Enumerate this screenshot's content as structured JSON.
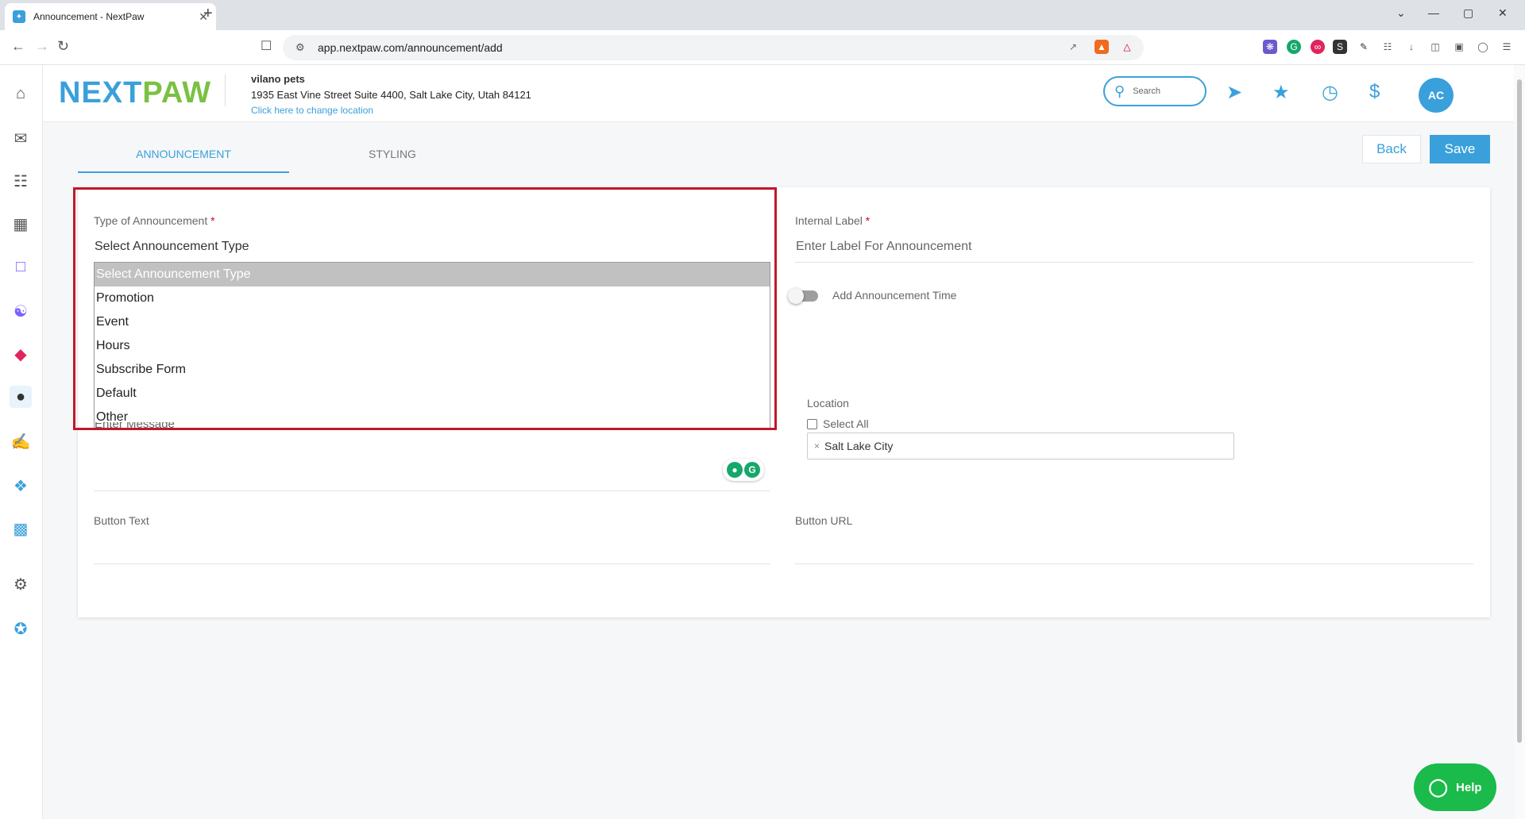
{
  "browser": {
    "tab_title": "Announcement - NextPaw",
    "new_tab": "+",
    "tab_close": "✕",
    "url": "app.nextpaw.com/announcement/add",
    "win_min": "—",
    "win_max": "▢",
    "win_close": "✕",
    "tab_list": "⌄"
  },
  "header": {
    "logo_part1": "NEXT",
    "logo_part2": "PAW",
    "business_name": "vilano pets",
    "business_address": "1935 East Vine Street Suite 4400, Salt Lake City, Utah 84121",
    "change_location_link": "Click here to change location",
    "search_placeholder": "Search",
    "avatar_initials": "AC"
  },
  "tabs": {
    "announcement": "ANNOUNCEMENT",
    "styling": "STYLING"
  },
  "actions": {
    "back": "Back",
    "save": "Save"
  },
  "form": {
    "type_label": "Type of Announcement",
    "required_mark": "*",
    "type_value": "Select Announcement Type",
    "type_options": [
      "Select Announcement Type",
      "Promotion",
      "Event",
      "Hours",
      "Subscribe Form",
      "Default",
      "Other"
    ],
    "internal_label": "Internal Label",
    "internal_placeholder": "Enter Label For Announcement",
    "time_toggle_label": "Add Announcement Time",
    "message_placeholder": "Enter Message",
    "location_label": "Location",
    "select_all_label": "Select All",
    "location_tag": "Salt Lake City",
    "button_text_label": "Button Text",
    "button_url_label": "Button URL"
  },
  "help": {
    "label": "Help"
  },
  "colors": {
    "accent": "#3aa0db",
    "logo_green": "#7ac143",
    "highlight_border": "#c0182c",
    "help_green": "#1aba4b"
  }
}
